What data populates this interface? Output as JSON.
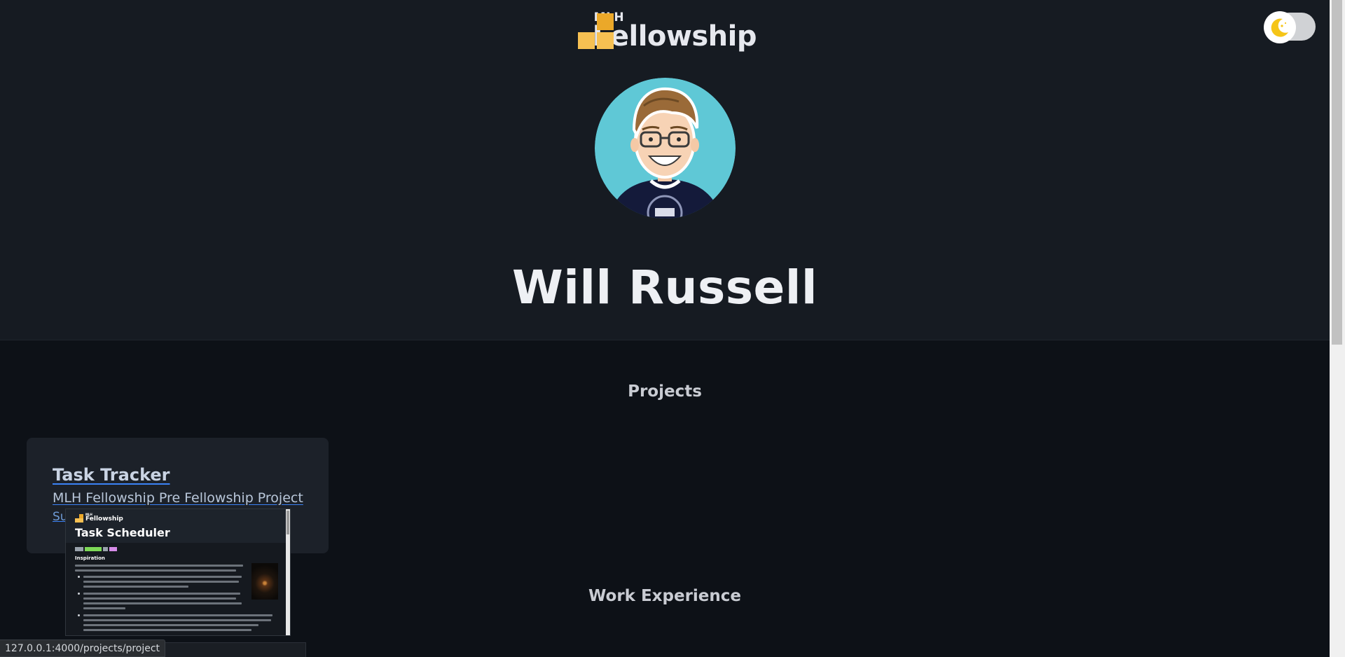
{
  "header": {
    "logo_small": "MLH",
    "logo_big": "Fellowship",
    "colors": {
      "logo_dark": "#eba829",
      "logo_light": "#f6c052"
    }
  },
  "theme_toggle": {
    "icon": "moon-icon",
    "state": "dark"
  },
  "profile": {
    "avatar_icon": "avatar-illustration",
    "name": "Will Russell"
  },
  "sections": {
    "projects_title": "Projects",
    "work_title": "Work Experience"
  },
  "projects": [
    {
      "title": "Task Tracker",
      "description": "MLH Fellowship Pre Fellowship Project",
      "extra_visible": "Su"
    }
  ],
  "link_preview": {
    "logo_small": "MLH",
    "logo_big": "Fellowship",
    "title": "Task Scheduler",
    "heading": "Inspiration"
  },
  "status_bar": {
    "url": "127.0.0.1:4000/projects/project"
  }
}
